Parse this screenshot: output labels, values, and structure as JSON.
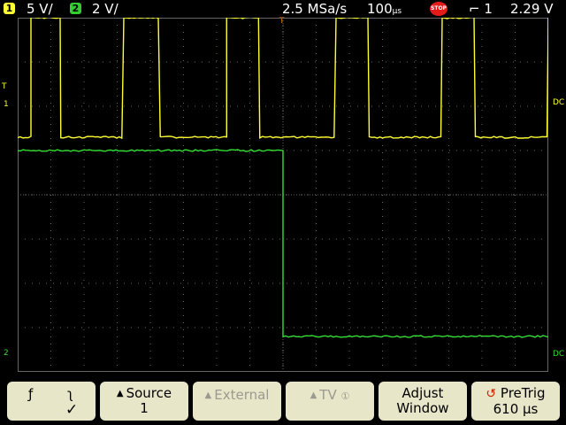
{
  "status": {
    "ch1_label": "1",
    "ch1_scale": "5 V/",
    "ch2_label": "2",
    "ch2_scale": "2 V/",
    "sample_rate": "2.5 MSa/s",
    "timebase": "100",
    "timebase_unit": "µs",
    "run_state": "STOP",
    "trig_slope_icon": "falling-edge-icon",
    "trig_source": "1",
    "trig_level": "2.29",
    "trig_level_unit": "V"
  },
  "markers": {
    "trig_level": "T",
    "ch1": "1",
    "ch2": "2",
    "dc1": "DC",
    "dc2": "DC",
    "trig_pos": "T"
  },
  "softkeys": {
    "slope_rise_icon": "rising-edge-icon",
    "slope_fall_icon": "falling-edge-icon",
    "slope_check": "✓",
    "source_label": "Source",
    "source_value": "1",
    "external_label": "External",
    "tv_label": "TV",
    "tv_num": "①",
    "adjust_line1": "Adjust",
    "adjust_line2": "Window",
    "pretrig_label": "PreTrig",
    "pretrig_value": "610 µs"
  },
  "colors": {
    "ch1": "#ffff33",
    "ch2": "#33dd33",
    "grid": "#666666",
    "key_bg": "#e8e6c9",
    "stop": "#e21b1b"
  },
  "waveforms": {
    "ch1": {
      "low_div": 5.3,
      "high_div": 8.0,
      "periods_div": [
        [
          0.4,
          1.3
        ],
        [
          3.2,
          4.3
        ],
        [
          6.3,
          7.3
        ],
        [
          9.6,
          10.6
        ],
        [
          12.8,
          13.8
        ],
        [
          16.0,
          16.3
        ]
      ]
    },
    "ch2": {
      "high_div": 5.0,
      "low_div": 0.8,
      "low_start_div": 8.0,
      "low_end_div": 16.3
    }
  }
}
